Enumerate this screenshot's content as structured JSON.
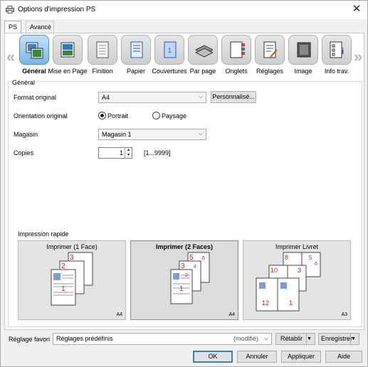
{
  "window": {
    "title": "Options d'impression PS"
  },
  "tabs": [
    {
      "label": "PS"
    },
    {
      "label": "Avancé"
    }
  ],
  "categories": [
    {
      "label": "Général",
      "icon": "general-icon"
    },
    {
      "label": "Mise en Page",
      "icon": "layout-icon"
    },
    {
      "label": "Finition",
      "icon": "finishing-icon"
    },
    {
      "label": "Papier",
      "icon": "paper-icon"
    },
    {
      "label": "Couvertures",
      "icon": "cover-icon"
    },
    {
      "label": "Par page",
      "icon": "per-page-icon"
    },
    {
      "label": "Onglets",
      "icon": "tabs-icon"
    },
    {
      "label": "Réglages",
      "icon": "settings-icon"
    },
    {
      "label": "Image",
      "icon": "image-icon"
    },
    {
      "label": "Info trav.",
      "icon": "job-info-icon"
    }
  ],
  "general": {
    "group_title": "Général",
    "format_label": "Format original",
    "format_value": "A4",
    "custom_button": "Personnalisé...",
    "orientation_label": "Orientation original",
    "portrait_label": "Portrait",
    "landscape_label": "Paysage",
    "tray_label": "Magasin",
    "tray_value": "Magasin 1",
    "copies_label": "Copies",
    "copies_value": "1",
    "copies_range": "[1...9999]"
  },
  "quick_print": {
    "title": "Impression rapide",
    "cards": [
      {
        "label": "Imprimer (1 Face)",
        "size": "A4",
        "pages": [
          "3",
          "2",
          "1"
        ]
      },
      {
        "label": "Imprimer (2 Faces)",
        "size": "A4",
        "pages": [
          "5",
          "6",
          "3",
          "4",
          "1",
          "2"
        ]
      },
      {
        "label": "Imprimer Livret",
        "size": "A3",
        "pages": [
          "8",
          "5",
          "6",
          "10",
          "3",
          "12",
          "1"
        ]
      }
    ]
  },
  "footer": {
    "favorite_label": "Réglage favori",
    "favorite_value": "Réglages prédéfinis",
    "favorite_modified": "(modifié)",
    "restore_button": "Rétablir",
    "save_button": "Enregistrer",
    "ok_button": "OK",
    "cancel_button": "Annuler",
    "apply_button": "Appliquer",
    "help_button": "Aide"
  }
}
